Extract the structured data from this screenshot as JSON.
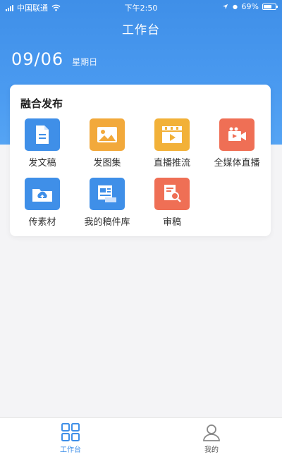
{
  "status_bar": {
    "carrier": "中国联通",
    "time": "下午2:50",
    "battery": "69%",
    "battery_level": 0.69
  },
  "header": {
    "title": "工作台",
    "date": "09/06",
    "weekday": "星期日"
  },
  "card": {
    "title": "融合发布",
    "items": [
      {
        "label": "发文稿",
        "icon": "document-icon",
        "color": "#3f8fe8"
      },
      {
        "label": "发图集",
        "icon": "image-icon",
        "color": "#f2a93b"
      },
      {
        "label": "直播推流",
        "icon": "video-icon",
        "color": "#f2b138"
      },
      {
        "label": "全媒体直播",
        "icon": "camera-icon",
        "color": "#ef6f55"
      },
      {
        "label": "传素材",
        "icon": "cloud-upload-icon",
        "color": "#3f8fe8"
      },
      {
        "label": "我的稿件库",
        "icon": "library-icon",
        "color": "#3f8fe8"
      },
      {
        "label": "审稿",
        "icon": "review-icon",
        "color": "#ef6f55"
      }
    ]
  },
  "tabbar": {
    "tabs": [
      {
        "label": "工作台",
        "icon": "grid-icon",
        "active": true,
        "color": "#3f8fe8"
      },
      {
        "label": "我的",
        "icon": "user-icon",
        "active": false,
        "color": "#888888"
      }
    ]
  }
}
